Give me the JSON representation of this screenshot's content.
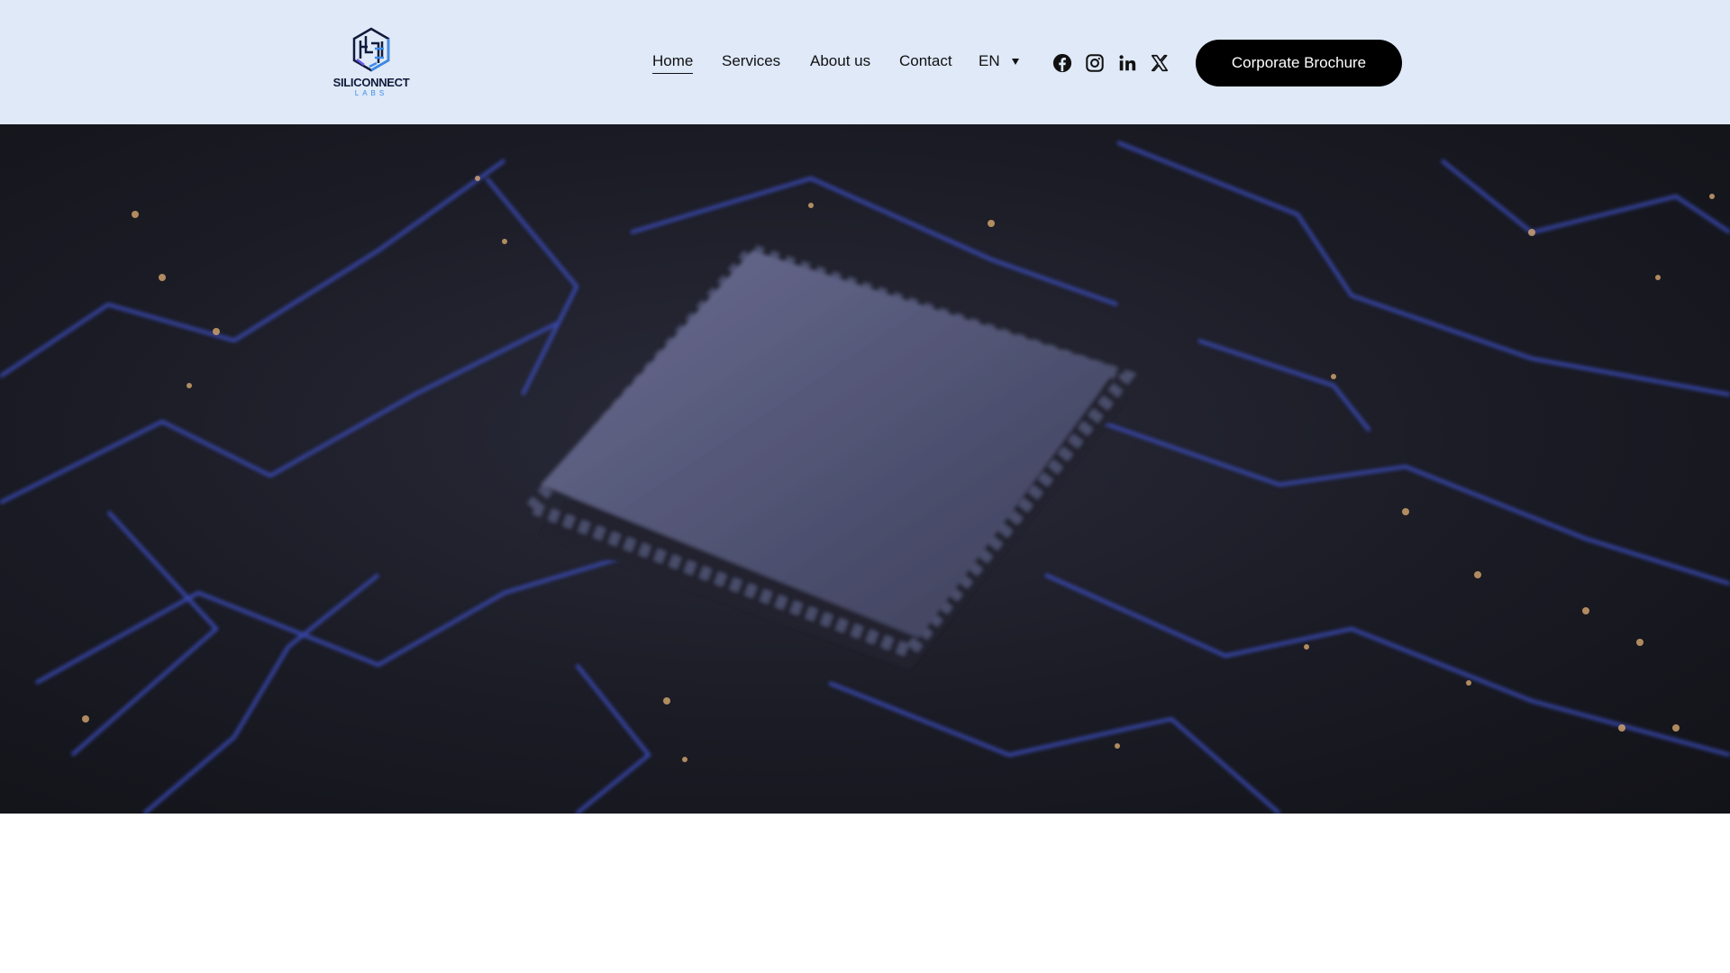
{
  "brand": {
    "name": "SILICONNECT",
    "sub": "LABS"
  },
  "nav": {
    "items": [
      {
        "label": "Home",
        "active": true
      },
      {
        "label": "Services"
      },
      {
        "label": "About us"
      },
      {
        "label": "Contact"
      }
    ],
    "language": "EN"
  },
  "social": [
    "facebook-icon",
    "instagram-icon",
    "linkedin-icon",
    "x-icon"
  ],
  "cta": {
    "label": "Corporate Brochure"
  },
  "colors": {
    "header_bg": "#dfe9f8",
    "accent": "#3b5bdb",
    "trace_light": "#d7a870"
  }
}
